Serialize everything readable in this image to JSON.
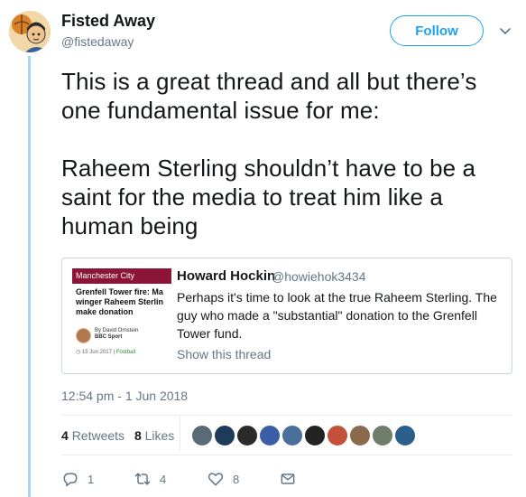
{
  "user": {
    "display_name": "Fisted Away",
    "handle": "@fistedaway",
    "follow_label": "Follow",
    "avatar_icon": "cartoon-avatar"
  },
  "tweet": {
    "paragraph_1": "This is a great thread and all but there’s one fundamental issue for me:",
    "paragraph_2": "Raheem Sterling shouldn’t have to be a saint for the media to treat him like a human being",
    "timestamp": "12:54 pm - 1 Jun 2018"
  },
  "quoted_tweet": {
    "name": "Howard Hockin",
    "handle": "@howiehok3434",
    "text": "Perhaps it's time to look at the true Raheem Sterling. The guy who made a \"substantial\" donation to the Grenfell Tower fund.",
    "show_thread": "Show this thread",
    "thumbnail": {
      "section": "Manchester City",
      "title_lines": [
        "Grenfell Tower fire: Ma",
        "winger Raheem Sterlin",
        "make donation"
      ],
      "byline_author": "By David Ornstein",
      "byline_org": "BBC Sport",
      "date": "15 Jun 2017",
      "tag": "Football"
    }
  },
  "stats": {
    "retweets_count": "4",
    "retweets_label": "Retweets",
    "likes_count": "8",
    "likes_label": "Likes"
  },
  "likers": [
    "#5a6b78",
    "#1f3a5a",
    "#2b2b2b",
    "#3b5ea8",
    "#4a6f9a",
    "#222222",
    "#c4513a",
    "#8a6a4a",
    "#6f7d6a",
    "#2c5f8a"
  ],
  "actions": {
    "reply_count": "1",
    "retweet_count": "4",
    "like_count": "8"
  },
  "colors": {
    "accent": "#1da1f2",
    "muted": "#657786",
    "thread_line": "#a7d4f0"
  }
}
